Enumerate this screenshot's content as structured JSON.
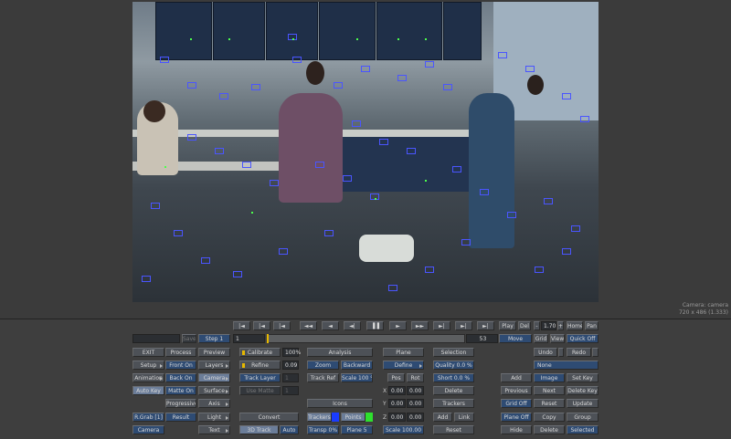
{
  "viewer": {
    "info_line1": "Camera: camera",
    "info_line2": "720 x 486 (1.333)"
  },
  "transport": {
    "buttons": [
      "|◄",
      "|◄",
      "|◄",
      "◄◄",
      "◄",
      "◄|",
      "▐▐",
      "►",
      "►►",
      "►|",
      "►|",
      "►|"
    ],
    "play": "Play",
    "del": "Del",
    "minus": "-",
    "speed": "1.70",
    "plus": "+",
    "home": "Home",
    "pan": "Pan"
  },
  "timeline": {
    "save": "Save",
    "step": "Step 1",
    "start_frame": "1",
    "end_frame": "53",
    "move": "Move",
    "grid": "Grid",
    "view": "View",
    "quick_off": "Quick Off"
  },
  "col1": {
    "exit": "EXIT",
    "setup": "Setup",
    "animation": "Animation",
    "auto_key": "Auto Key",
    "rgrab": "R.Grab [1]",
    "camera": "Camera"
  },
  "col2": {
    "process": "Process",
    "front_on": "Front On",
    "back_on": "Back On",
    "matte_on": "Matte On",
    "progressive": "Progressive",
    "result": "Result"
  },
  "col3": {
    "preview": "Preview",
    "layers": "Layers",
    "camera": "Camera",
    "surface": "Surface",
    "axis": "Axis",
    "light": "Light",
    "text": "Text"
  },
  "col4": {
    "calibrate": "Calibrate",
    "refine": "Refine",
    "track_layer": "Track Layer",
    "use_matte": "Use Matte",
    "convert": "Convert",
    "track_3d": "3D Track",
    "auto": "Auto",
    "pct": "100%",
    "val": "0.09",
    "f1": "1",
    "f2": "1"
  },
  "col5": {
    "analysis": "Analysis",
    "zoom": "Zoom",
    "backward": "Backward",
    "track_ref": "Track Ref",
    "scale": "Scale 100 %",
    "icons": "Icons",
    "trackers": "Trackers",
    "points": "Points",
    "transp": "Transp 0%",
    "plane5": "Plane 5",
    "green_color": "#2ee02e",
    "blue_color": "#1a3cff"
  },
  "col6": {
    "plane": "Plane",
    "define": "Define",
    "pos": "Pos",
    "rot": "Rot",
    "x": "X",
    "y": "Y",
    "z": "Z",
    "x1": "0.00",
    "x2": "0.00",
    "y1": "0.00",
    "y2": "0.00",
    "z1": "0.00",
    "z2": "0.00",
    "scale": "Scale 100.00"
  },
  "col7": {
    "selection": "Selection",
    "quality": "Quality 0.0 %",
    "short": "Short 0.0 %",
    "delete": "Delete",
    "trackers": "Trackers",
    "add": "Add",
    "link": "Link",
    "reset": "Reset"
  },
  "col8": {
    "add": "Add",
    "previous": "Previous",
    "grid_off": "Grid Off",
    "plane_off": "Plane Off",
    "hide": "Hide"
  },
  "col9": {
    "undo": "Undo",
    "none": "None",
    "image": "Image",
    "next": "Next",
    "reset": "Reset",
    "copy": "Copy",
    "delete": "Delete"
  },
  "col10": {
    "redo": "Redo",
    "set_key": "Set Key",
    "delete_key": "Delete Key",
    "update": "Update",
    "group": "Group",
    "selected": "Selected"
  }
}
